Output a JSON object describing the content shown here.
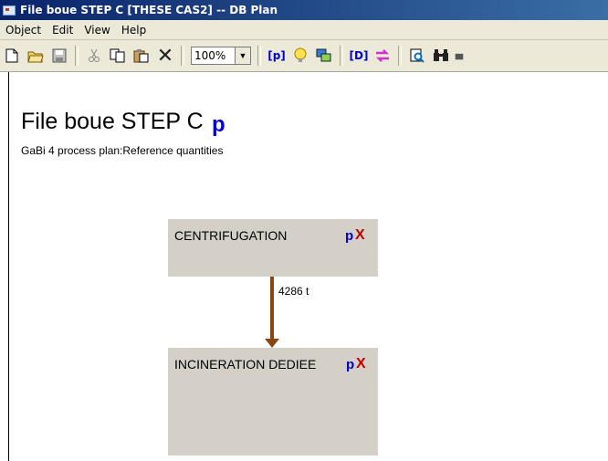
{
  "window": {
    "title": "File boue STEP C [THESE CAS2] -- DB Plan"
  },
  "menu": {
    "items": [
      "Object",
      "Edit",
      "View",
      "Help"
    ]
  },
  "toolbar": {
    "zoom_value": "100%",
    "buttons": [
      {
        "icon": "new-icon"
      },
      {
        "icon": "open-icon"
      },
      {
        "icon": "save-icon"
      },
      {
        "icon": "cut-icon"
      },
      {
        "icon": "copy-icon"
      },
      {
        "icon": "paste-icon"
      },
      {
        "icon": "delete-icon"
      },
      {
        "icon": "zoom-dropdown"
      },
      {
        "icon": "process-p-icon"
      },
      {
        "icon": "bulb-icon"
      },
      {
        "icon": "layers-icon"
      },
      {
        "icon": "db-icon"
      },
      {
        "icon": "arrows-icon"
      },
      {
        "icon": "inspect-icon"
      },
      {
        "icon": "binoculars-icon"
      }
    ],
    "p_label": "[p]",
    "db_label": "[D]"
  },
  "plan": {
    "heading": "File boue STEP C",
    "heading_p": "p",
    "subtitle": "GaBi 4 process plan:Reference quantities"
  },
  "processes": [
    {
      "name": "CENTRIFUGATION",
      "p": "p",
      "x": "X"
    },
    {
      "name": "INCINERATION DEDIEE",
      "p": "p",
      "x": "X"
    }
  ],
  "flows": [
    {
      "label": "4286 t"
    }
  ],
  "colors": {
    "title_bar_start": "#0a246a",
    "title_bar_end": "#3a6ea5",
    "process_box": "#d4d0c8",
    "flow_arrow": "#8b4513",
    "p_blue": "#0000cc",
    "x_red": "#c00000"
  }
}
